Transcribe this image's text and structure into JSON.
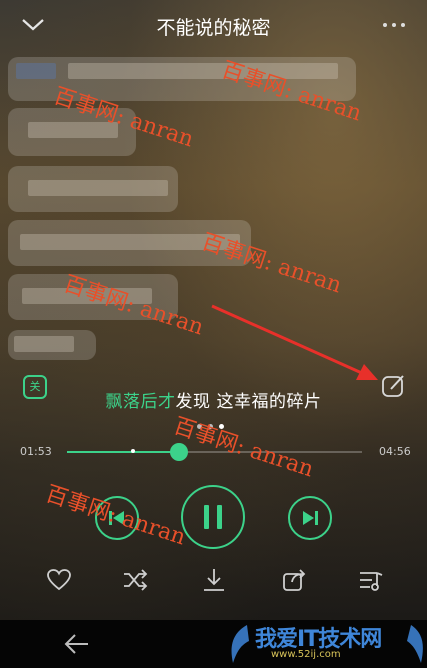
{
  "header": {
    "title": "不能说的秘密"
  },
  "comments": [
    {
      "id": "c1"
    },
    {
      "id": "c2"
    },
    {
      "id": "c3"
    },
    {
      "id": "c4"
    },
    {
      "id": "c5"
    },
    {
      "id": "c6"
    }
  ],
  "danmu_toggle": {
    "label": "关"
  },
  "lyric": {
    "highlight": "飘落后才",
    "rest": "发现 这幸福的碎片"
  },
  "player": {
    "current_time": "01:53",
    "total_time": "04:56",
    "progress": 0.38
  },
  "controls": {
    "prev": "previous-icon",
    "play_pause": "pause-icon",
    "next": "next-icon"
  },
  "bottom_actions": [
    "heart-icon",
    "shuffle-icon",
    "download-icon",
    "share-icon",
    "playlist-icon"
  ],
  "watermark": {
    "text": "百事网: anran"
  },
  "site_logo": {
    "name": "我爱IT技术网",
    "url": "www.52ij.com"
  },
  "colors": {
    "accent": "#3cd28a",
    "watermark": "#e8502a",
    "arrow": "#e8302a"
  }
}
